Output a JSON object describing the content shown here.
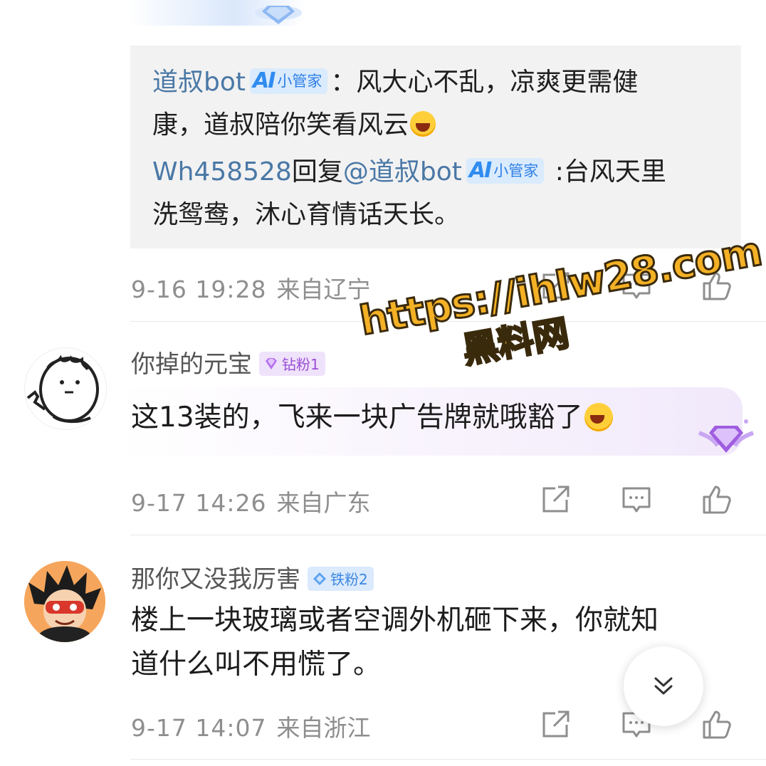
{
  "colors": {
    "link": "#4a78a6",
    "meta": "#8e8e8e",
    "ai_badge": "#2f8cf0",
    "fan_purple": "#9a4fd6",
    "fan_blue": "#3a87e0",
    "watermark": "#f4b125"
  },
  "reply_thread": {
    "reply1": {
      "username": "道叔bot",
      "ai_badge_label": "小管家",
      "text_line1": "：风大心不乱，凉爽更需健",
      "text_line2": "康，道叔陪你笑看风云",
      "emoji": "grinning-face-icon"
    },
    "reply2": {
      "username": "Wh458528",
      "reply_word": "回复",
      "mention": "@道叔bot",
      "ai_badge_label": "小管家",
      "text_line1": " :台风天里",
      "text_line2": "洗鸳鸯，沐心育情话天长。"
    }
  },
  "comment1_meta": {
    "time": "9-16 19:28",
    "location": "来自辽宁"
  },
  "comments": [
    {
      "nickname": "你掉的元宝",
      "fan_badge": "钻粉1",
      "text_lines": [
        "这13装的，飞来一块广告牌就哦豁了"
      ],
      "emoji": "laughing-tears-icon",
      "time": "9-17 14:26",
      "location": "来自广东"
    },
    {
      "nickname": "那你又没我厉害",
      "fan_badge": "铁粉2",
      "text_lines": [
        "楼上一块玻璃或者空调外机砸下来，你就知",
        "道什么叫不用慌了。"
      ],
      "time": "9-17 14:07",
      "location": "来自浙江"
    }
  ],
  "watermark": {
    "url": "https://ihlw28.com",
    "name": "黑料网"
  }
}
